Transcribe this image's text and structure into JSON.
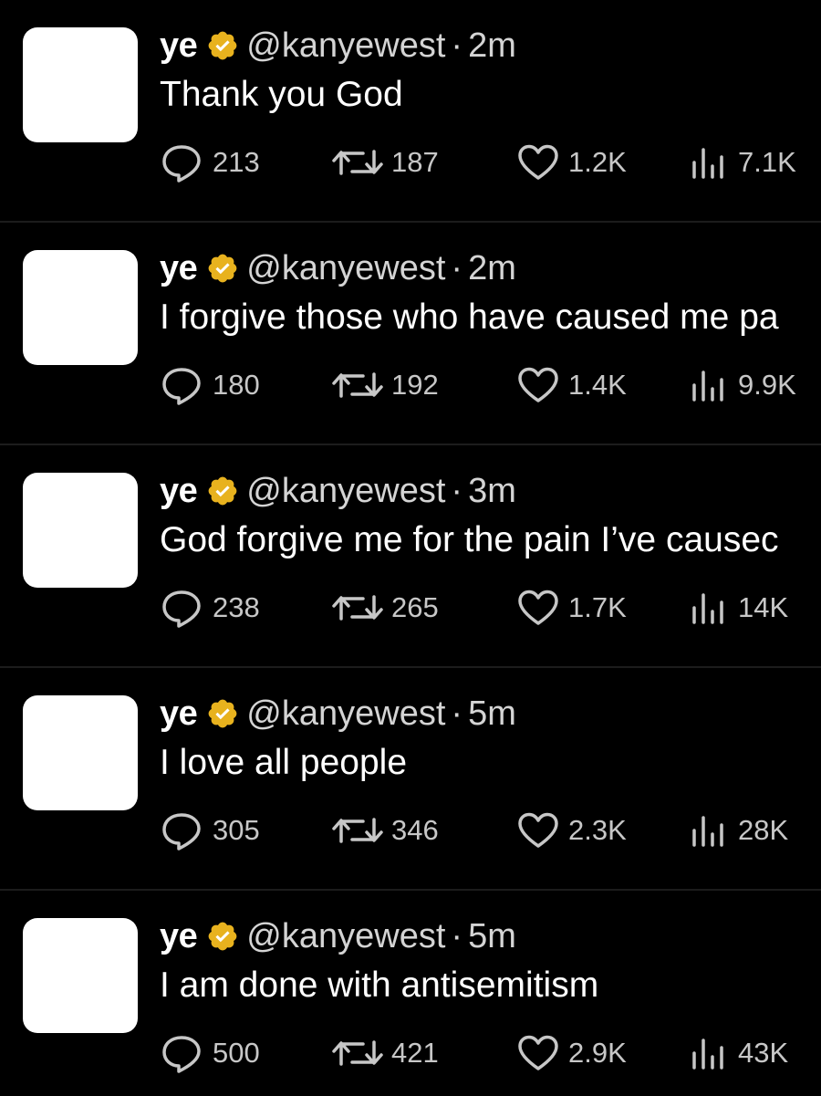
{
  "tweets": [
    {
      "name": "ye",
      "handle": "@kanyewest",
      "separator": "·",
      "time": "2m",
      "text": "Thank you God",
      "replies": "213",
      "retweets": "187",
      "likes": "1.2K",
      "views": "7.1K"
    },
    {
      "name": "ye",
      "handle": "@kanyewest",
      "separator": "·",
      "time": "2m",
      "text": "I forgive those who have caused me pa",
      "replies": "180",
      "retweets": "192",
      "likes": "1.4K",
      "views": "9.9K"
    },
    {
      "name": "ye",
      "handle": "@kanyewest",
      "separator": "·",
      "time": "3m",
      "text": "God forgive me for the pain I’ve causec",
      "replies": "238",
      "retweets": "265",
      "likes": "1.7K",
      "views": "14K"
    },
    {
      "name": "ye",
      "handle": "@kanyewest",
      "separator": "·",
      "time": "5m",
      "text": "I love all people",
      "replies": "305",
      "retweets": "346",
      "likes": "2.3K",
      "views": "28K"
    },
    {
      "name": "ye",
      "handle": "@kanyewest",
      "separator": "·",
      "time": "5m",
      "text": "I am done with antisemitism",
      "replies": "500",
      "retweets": "421",
      "likes": "2.9K",
      "views": "43K"
    }
  ],
  "icons": {
    "verified": "verified-badge-icon",
    "reply": "reply-icon",
    "retweet": "retweet-icon",
    "like": "heart-icon",
    "views": "views-icon"
  },
  "colors": {
    "background": "#000000",
    "verified_badge": "#e8b21e",
    "text": "#ffffff",
    "secondary_text": "#d4d4d4",
    "divider": "#1c1c1c"
  }
}
